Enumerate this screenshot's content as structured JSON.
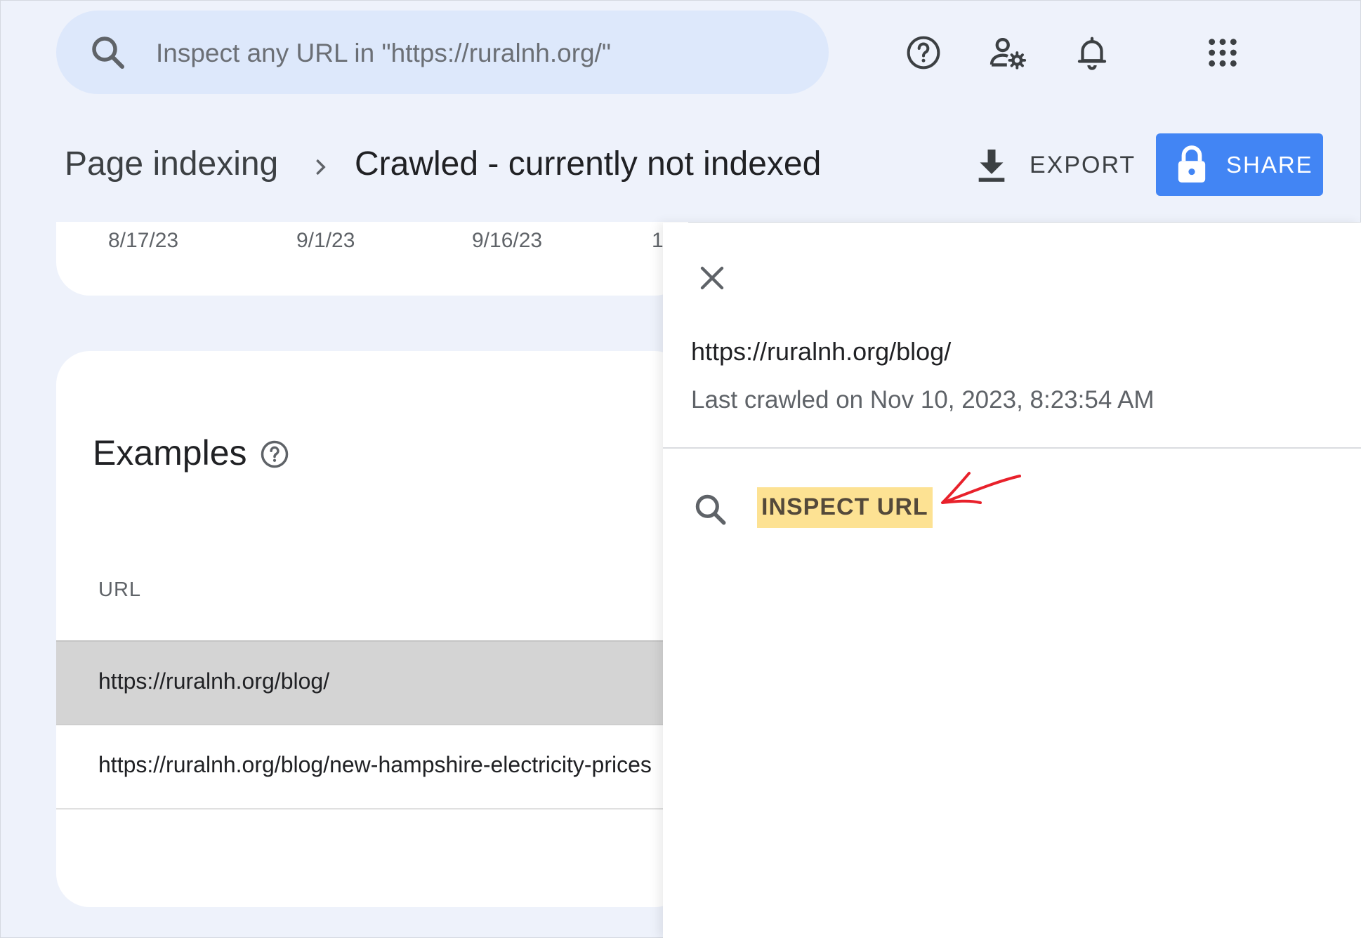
{
  "search": {
    "placeholder": "Inspect any URL in \"https://ruralnh.org/\""
  },
  "top_icons": [
    "help-icon",
    "manage-users-icon",
    "notifications-bell-icon",
    "apps-grid-icon"
  ],
  "header": {
    "breadcrumb_root": "Page indexing",
    "breadcrumb_current": "Crawled - currently not indexed",
    "export_label": "EXPORT",
    "share_label": "SHARE"
  },
  "chart": {
    "x_ticks": [
      "8/17/23",
      "9/1/23",
      "9/16/23",
      "1"
    ]
  },
  "examples": {
    "title": "Examples",
    "column_header": "URL",
    "rows": [
      "https://ruralnh.org/blog/",
      "https://ruralnh.org/blog/new-hampshire-electricity-prices"
    ]
  },
  "panel": {
    "url": "https://ruralnh.org/blog/",
    "last_crawled": "Last crawled on Nov 10, 2023, 8:23:54 AM",
    "inspect_label": "INSPECT URL"
  },
  "colors": {
    "page_background": "#eef2fb",
    "search_background": "#dde8fb",
    "share_button": "#4285f4",
    "selected_row": "#d4d4d4",
    "highlight": "#fde293",
    "annotation_arrow": "#e8212b"
  }
}
